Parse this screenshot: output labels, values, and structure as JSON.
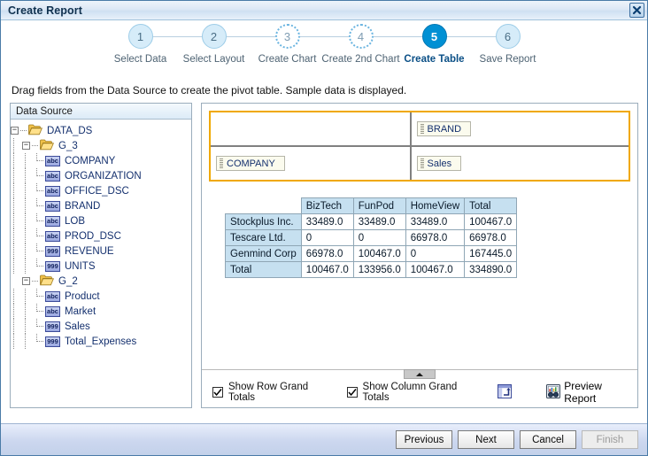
{
  "window": {
    "title": "Create Report",
    "close_icon": "close-icon"
  },
  "stepper": {
    "steps": [
      {
        "num": "1",
        "label": "Select Data",
        "state": "done"
      },
      {
        "num": "2",
        "label": "Select Layout",
        "state": "done"
      },
      {
        "num": "3",
        "label": "Create Chart",
        "state": "todo-dot"
      },
      {
        "num": "4",
        "label": "Create 2nd Chart",
        "state": "todo-dot"
      },
      {
        "num": "5",
        "label": "Create Table",
        "state": "current"
      },
      {
        "num": "6",
        "label": "Save Report",
        "state": "done"
      }
    ]
  },
  "instruction": "Drag fields from the Data Source to create the pivot table. Sample data is displayed.",
  "tree": {
    "header": "Data Source",
    "nodes": [
      {
        "label": "DATA_DS",
        "type": "folder",
        "depth": 0,
        "toggle": "-"
      },
      {
        "label": "G_3",
        "type": "folder",
        "depth": 1,
        "toggle": "-"
      },
      {
        "label": "COMPANY",
        "type": "abc",
        "depth": 2
      },
      {
        "label": "ORGANIZATION",
        "type": "abc",
        "depth": 2
      },
      {
        "label": "OFFICE_DSC",
        "type": "abc",
        "depth": 2
      },
      {
        "label": "BRAND",
        "type": "abc",
        "depth": 2
      },
      {
        "label": "LOB",
        "type": "abc",
        "depth": 2
      },
      {
        "label": "PROD_DSC",
        "type": "abc",
        "depth": 2
      },
      {
        "label": "REVENUE",
        "type": "999",
        "depth": 2
      },
      {
        "label": "UNITS",
        "type": "999",
        "depth": 2,
        "last": true
      },
      {
        "label": "G_2",
        "type": "folder",
        "depth": 1,
        "toggle": "-",
        "last": true
      },
      {
        "label": "Product",
        "type": "abc",
        "depth": 2
      },
      {
        "label": "Market",
        "type": "abc",
        "depth": 2
      },
      {
        "label": "Sales",
        "type": "999",
        "depth": 2
      },
      {
        "label": "Total_Expenses",
        "type": "999",
        "depth": 2,
        "last": true
      }
    ],
    "icon_names": {
      "folder": "folder-icon",
      "abc": "text-field-icon",
      "999": "number-field-icon"
    }
  },
  "dropzone": {
    "border_color": "#f0a800",
    "top_left_chip": "",
    "top_right_chip": "BRAND",
    "bottom_left_chip": "COMPANY",
    "bottom_right_chip": "Sales"
  },
  "chart_data": {
    "type": "table",
    "title": "",
    "columns": [
      "",
      "BizTech",
      "FunPod",
      "HomeView",
      "Total"
    ],
    "rows": [
      {
        "label": "Stockplus Inc.",
        "values": [
          "33489.0",
          "33489.0",
          "33489.0",
          "100467.0"
        ]
      },
      {
        "label": "Tescare Ltd.",
        "values": [
          "0",
          "0",
          "66978.0",
          "66978.0"
        ]
      },
      {
        "label": "Genmind Corp",
        "values": [
          "66978.0",
          "100467.0",
          "0",
          "167445.0"
        ]
      },
      {
        "label": "Total",
        "values": [
          "100467.0",
          "133956.0",
          "100467.0",
          "334890.0"
        ]
      }
    ],
    "row_field": "COMPANY",
    "column_field": "BRAND",
    "measure_field": "Sales"
  },
  "splitter": {
    "handle_icon": "collapse-up-icon"
  },
  "options": {
    "show_row_grand_totals": {
      "label": "Show Row Grand Totals",
      "checked": true
    },
    "show_column_grand_totals": {
      "label": "Show Column Grand Totals",
      "checked": true
    },
    "swap_icon": "swap-rows-columns-icon",
    "preview": {
      "label": "Preview Report",
      "icon": "preview-report-icon"
    }
  },
  "footer": {
    "previous": "Previous",
    "next": "Next",
    "cancel": "Cancel",
    "finish": "Finish",
    "finish_disabled": true
  }
}
